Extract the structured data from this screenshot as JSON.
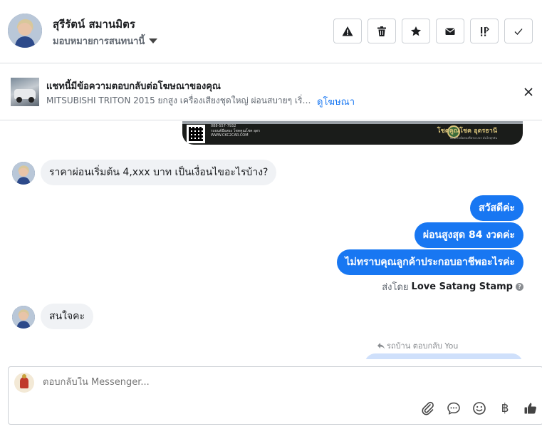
{
  "header": {
    "contact_name": "สุรีรัตน์ สมานมิตร",
    "assign_label": "มอบหมายการสนทนานี้",
    "actions": [
      {
        "name": "report-spam-button",
        "icon": "warning-icon"
      },
      {
        "name": "delete-button",
        "icon": "trash-icon"
      },
      {
        "name": "star-button",
        "icon": "star-icon"
      },
      {
        "name": "mark-unread-button",
        "icon": "envelope-icon"
      },
      {
        "name": "follow-up-button",
        "icon": "follow-up-icon"
      },
      {
        "name": "mark-done-button",
        "icon": "check-icon"
      }
    ]
  },
  "ad_banner": {
    "title": "แชทนี้มีข้อความตอบกลับต่อโฆษณาของคุณ",
    "description": "MITSUBISHI TRITON 2015 ยกสูง เครื่องเสียงชุดใหญ่ ผ่อนสบายๆ เริ่มต้...",
    "link_label": "ดูโฆษณา"
  },
  "ad_image": {
    "phone": "088-557-7932",
    "line2": "รถยนต์มือสอง โชคคูณโชค อุดร",
    "site": "WWW.CKC2CAR.COM",
    "brand": "โชคคูณโชค อุดรธานี",
    "brand_sub": "เต็นท์รถมือสองที่ครบวงจร มั่นใจทุกคัน"
  },
  "messages": [
    {
      "direction": "in",
      "text": "ราคาผ่อนเริ่มต้น 4,xxx บาท เป็นเงื่อนไขอะไรบ้าง?"
    },
    {
      "direction": "out",
      "text": "สวัสดีค่ะ"
    },
    {
      "direction": "out",
      "text": "ผ่อนสูงสุด 84 งวดค่ะ"
    },
    {
      "direction": "out",
      "text": "ไม่ทราบคุณลูกค้าประกอบอาชีพอะไรค่ะ"
    },
    {
      "direction": "in",
      "text": "สนใจคะ"
    }
  ],
  "sent_by": {
    "prefix": "ส่งโดย",
    "sender": "Love Satang Stamp",
    "help": "?"
  },
  "reply_note": "รถบ้าน ตอบกลับ You",
  "composer": {
    "placeholder": "ตอบกลับใน Messenger...",
    "baht_symbol": "฿",
    "tools": [
      "paperclip-icon",
      "chat-bubble-icon",
      "emoji-icon",
      "baht-icon",
      "thumbs-up-icon"
    ]
  },
  "colors": {
    "accent": "#1877f2",
    "bubble_in": "#f0f2f5",
    "border": "#dadde1"
  }
}
